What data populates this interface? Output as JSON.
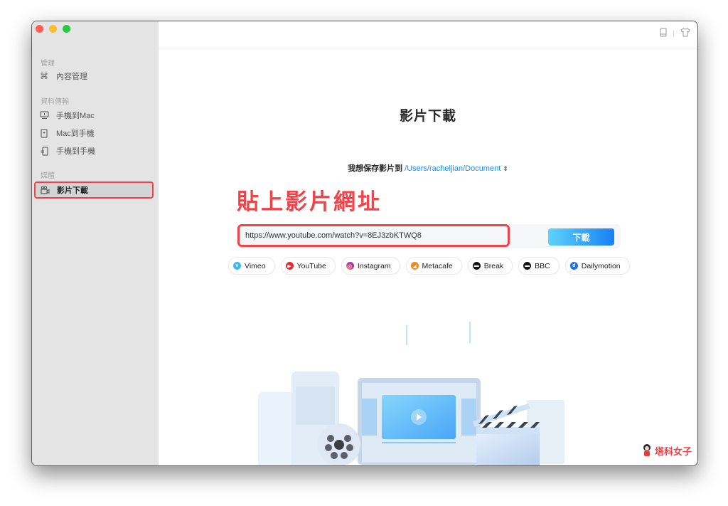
{
  "window": {
    "traffic_lights": [
      "close",
      "minimize",
      "zoom"
    ]
  },
  "sidebar": {
    "sections": [
      {
        "label": "管理",
        "items": [
          {
            "label": "內容管理",
            "icon": "command-icon"
          }
        ]
      },
      {
        "label": "資料傳輸",
        "items": [
          {
            "label": "手機到Mac",
            "icon": "phone-to-mac-icon"
          },
          {
            "label": "Mac到手機",
            "icon": "mac-to-phone-icon"
          },
          {
            "label": "手機到手機",
            "icon": "phone-to-phone-icon"
          }
        ]
      },
      {
        "label": "媒體",
        "items": [
          {
            "label": "影片下載",
            "icon": "video-camera-icon",
            "active": true
          }
        ]
      }
    ]
  },
  "topbar": {
    "icons": [
      "device-icon",
      "tshirt-icon"
    ]
  },
  "main": {
    "title": "影片下載",
    "save_label": "我想保存影片到",
    "save_path": "/Users/racheljian/Document",
    "annotation": "貼上影片網址",
    "url_value": "https://www.youtube.com/watch?v=8EJ3zbKTWQ8",
    "download_button": "下載",
    "sites": [
      {
        "label": "Vimeo",
        "color": "#3fb8f2",
        "glyph": "v"
      },
      {
        "label": "YouTube",
        "color": "#e8262c",
        "glyph": "▶"
      },
      {
        "label": "Instagram",
        "color": "#c2379a",
        "glyph": "◎"
      },
      {
        "label": "Metacafe",
        "color": "#f08a1c",
        "glyph": "◢"
      },
      {
        "label": "Break",
        "color": "#111111",
        "glyph": "▬"
      },
      {
        "label": "BBC",
        "color": "#111111",
        "glyph": "▬"
      },
      {
        "label": "Dailymotion",
        "color": "#1a6ff0",
        "glyph": "d"
      }
    ]
  },
  "watermark": "塔科女子",
  "colors": {
    "accent": "#1b8cf2",
    "annotation_red": "#f0434a",
    "sidebar_bg": "#e4e4e4"
  }
}
